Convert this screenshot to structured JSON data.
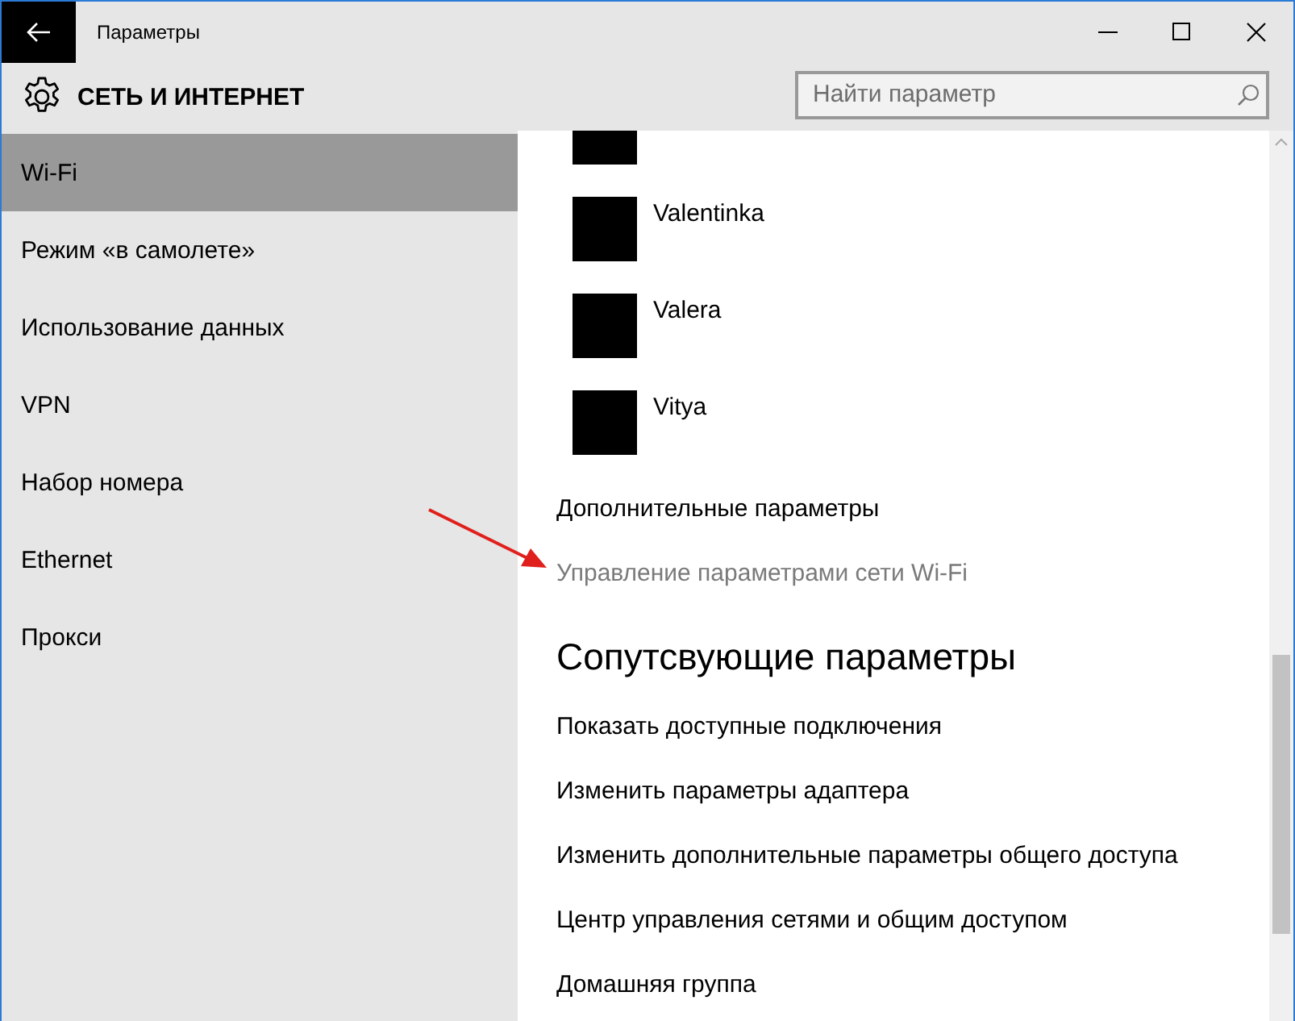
{
  "window": {
    "title": "Параметры"
  },
  "header": {
    "title": "СЕТЬ И ИНТЕРНЕТ",
    "search": {
      "placeholder": "Найти параметр"
    }
  },
  "sidebar": {
    "items": [
      {
        "label": "Wi-Fi",
        "selected": true
      },
      {
        "label": "Режим «в самолете»",
        "selected": false
      },
      {
        "label": "Использование данных",
        "selected": false
      },
      {
        "label": "VPN",
        "selected": false
      },
      {
        "label": "Набор номера",
        "selected": false
      },
      {
        "label": "Ethernet",
        "selected": false
      },
      {
        "label": "Прокси",
        "selected": false
      }
    ]
  },
  "networks": [
    {
      "kind": "partial"
    },
    {
      "kind": "full",
      "name": "Valentinka"
    },
    {
      "kind": "full",
      "name": "Valera"
    },
    {
      "kind": "full",
      "name": "Vitya"
    }
  ],
  "links": [
    {
      "label": "Дополнительные параметры",
      "disabled": false
    },
    {
      "label": "Управление параметрами сети Wi-Fi",
      "disabled": true
    }
  ],
  "related": {
    "heading": "Сопутсвующие параметры",
    "links": [
      {
        "label": "Показать доступные подключения"
      },
      {
        "label": "Изменить параметры адаптера"
      },
      {
        "label": "Изменить дополнительные параметры общего доступа"
      },
      {
        "label": "Центр управления сетями и общим доступом"
      },
      {
        "label": "Домашняя группа"
      }
    ]
  }
}
